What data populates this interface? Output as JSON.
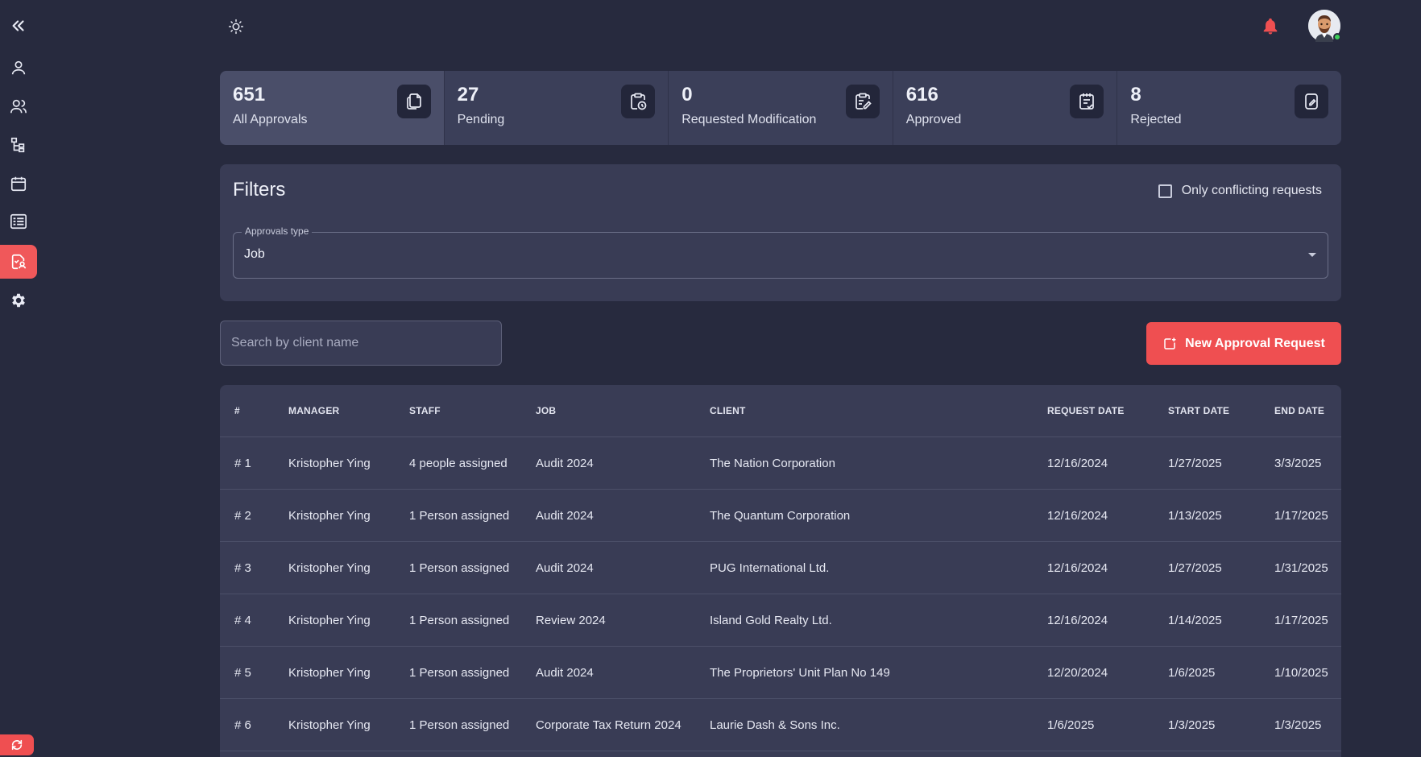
{
  "stats": [
    {
      "value": "651",
      "label": "All Approvals"
    },
    {
      "value": "27",
      "label": "Pending"
    },
    {
      "value": "0",
      "label": "Requested Modification"
    },
    {
      "value": "616",
      "label": "Approved"
    },
    {
      "value": "8",
      "label": "Rejected"
    }
  ],
  "filters": {
    "title": "Filters",
    "conflict_label": "Only conflicting requests",
    "approvals_type_label": "Approvals type",
    "approvals_type_value": "Job"
  },
  "search": {
    "placeholder": "Search by client name"
  },
  "new_button": {
    "label": "New Approval Request"
  },
  "table": {
    "headers": [
      "#",
      "MANAGER",
      "STAFF",
      "JOB",
      "CLIENT",
      "REQUEST DATE",
      "START DATE",
      "END DATE"
    ],
    "rows": [
      [
        "# 1",
        "Kristopher Ying",
        "4 people assigned",
        "Audit 2024",
        "The Nation Corporation",
        "12/16/2024",
        "1/27/2025",
        "3/3/2025"
      ],
      [
        "# 2",
        "Kristopher Ying",
        "1 Person assigned",
        "Audit 2024",
        "The Quantum Corporation",
        "12/16/2024",
        "1/13/2025",
        "1/17/2025"
      ],
      [
        "# 3",
        "Kristopher Ying",
        "1 Person assigned",
        "Audit 2024",
        "PUG International Ltd.",
        "12/16/2024",
        "1/27/2025",
        "1/31/2025"
      ],
      [
        "# 4",
        "Kristopher Ying",
        "1 Person assigned",
        "Review 2024",
        "Island Gold Realty Ltd.",
        "12/16/2024",
        "1/14/2025",
        "1/17/2025"
      ],
      [
        "# 5",
        "Kristopher Ying",
        "1 Person assigned",
        "Audit 2024",
        "The Proprietors' Unit Plan No 149",
        "12/20/2024",
        "1/6/2025",
        "1/10/2025"
      ],
      [
        "# 6",
        "Kristopher Ying",
        "1 Person assigned",
        "Corporate Tax Return 2024",
        "Laurie Dash & Sons Inc.",
        "1/6/2025",
        "1/3/2025",
        "1/3/2025"
      ]
    ]
  },
  "colors": {
    "background": "#272a3e",
    "accent": "#ef4f51",
    "card": "#3b3f59",
    "online": "#3ecf5a"
  }
}
